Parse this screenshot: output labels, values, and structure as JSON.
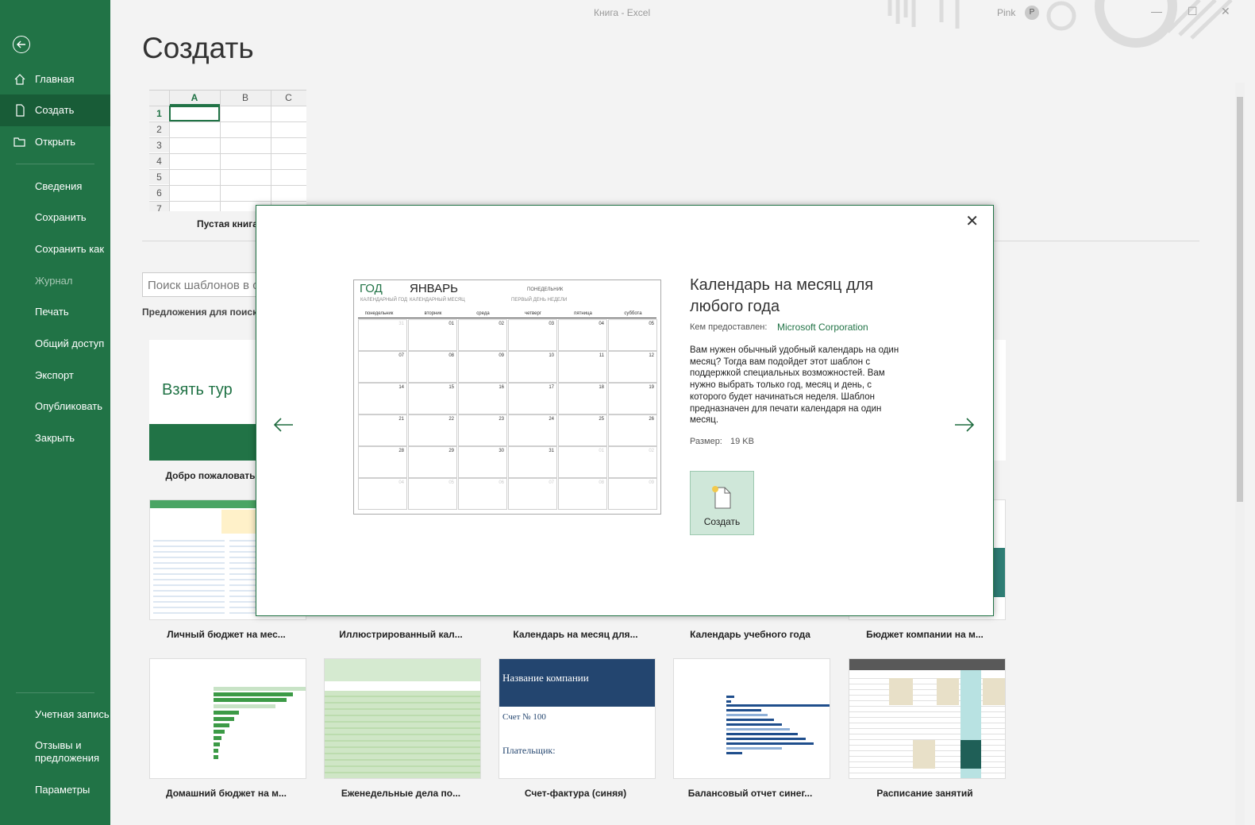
{
  "window": {
    "title": "Книга  -  Excel",
    "user_name": "Pink",
    "user_initial": "P"
  },
  "sidebar": {
    "items": [
      {
        "label": "Главная"
      },
      {
        "label": "Создать"
      },
      {
        "label": "Открыть"
      },
      {
        "label": "Сведения"
      },
      {
        "label": "Сохранить"
      },
      {
        "label": "Сохранить как"
      },
      {
        "label": "Журнал"
      },
      {
        "label": "Печать"
      },
      {
        "label": "Общий доступ"
      },
      {
        "label": "Экспорт"
      },
      {
        "label": "Опубликовать"
      },
      {
        "label": "Закрыть"
      }
    ],
    "bottom": [
      {
        "label": "Учетная запись"
      },
      {
        "label": "Отзывы и"
      },
      {
        "label": "предложения"
      },
      {
        "label": "Параметры"
      }
    ]
  },
  "main": {
    "title": "Создать",
    "blank_label": "Пустая книга",
    "grid": {
      "cols": [
        "A",
        "B",
        "C"
      ],
      "rows": [
        "1",
        "2",
        "3",
        "4",
        "5",
        "6",
        "7"
      ]
    },
    "search_placeholder": "Поиск шаблонов в с",
    "suggest_label": "Предложения для поиск",
    "tour_text": "Взять тур",
    "templates": [
      {
        "label": "Добро пожаловать"
      },
      {
        "label": "Личный бюджет на мес..."
      },
      {
        "label": "Иллюстрированный кал..."
      },
      {
        "label": "Календарь на месяц для..."
      },
      {
        "label": "Календарь учебного года"
      },
      {
        "label": "Бюджет компании на м..."
      },
      {
        "label": "Домашний бюджет на м..."
      },
      {
        "label": "Еженедельные дела по..."
      },
      {
        "label": "Счет-фактура (синяя)"
      },
      {
        "label": "Балансовый отчет синег..."
      },
      {
        "label": "Расписание занятий"
      }
    ],
    "invoice_thumb": {
      "company": "Название компании",
      "number": "Счет № 100",
      "payer": "Плательщик:"
    }
  },
  "preview": {
    "title": "Календарь на месяц для любого года",
    "provider_label": "Кем предоставлен:",
    "provider": "Microsoft Corporation",
    "description": "Вам нужен обычный удобный календарь на один месяц? Тогда вам подойдет этот шаблон с поддержкой специальных возможностей. Вам нужно выбрать только год, месяц и день, с которого будет начинаться неделя. Шаблон предназначен для печати календаря на один месяц.",
    "size_label": "Размер:",
    "size": "19 KB",
    "create_label": "Создать",
    "calendar": {
      "year": "ГОД",
      "month": "ЯНВАРЬ",
      "year_sub": "КАЛЕНДАРНЫЙ ГОД",
      "month_sub": "КАЛЕНДАРНЫЙ МЕСЯЦ",
      "monday": "ПОНЕДЕЛЬНИК",
      "first_day": "ПЕРВЫЙ ДЕНЬ НЕДЕЛИ",
      "days": [
        "понедельник",
        "вторник",
        "среда",
        "четверг",
        "пятница",
        "суббота"
      ],
      "cells": [
        [
          "31",
          "01",
          "02",
          "03",
          "04",
          "05"
        ],
        [
          "07",
          "08",
          "09",
          "10",
          "11",
          "12"
        ],
        [
          "14",
          "15",
          "16",
          "17",
          "18",
          "19"
        ],
        [
          "21",
          "22",
          "23",
          "24",
          "25",
          "26"
        ],
        [
          "28",
          "29",
          "30",
          "31",
          "01",
          "02"
        ],
        [
          "04",
          "05",
          "06",
          "07",
          "08",
          "09"
        ]
      ]
    }
  }
}
